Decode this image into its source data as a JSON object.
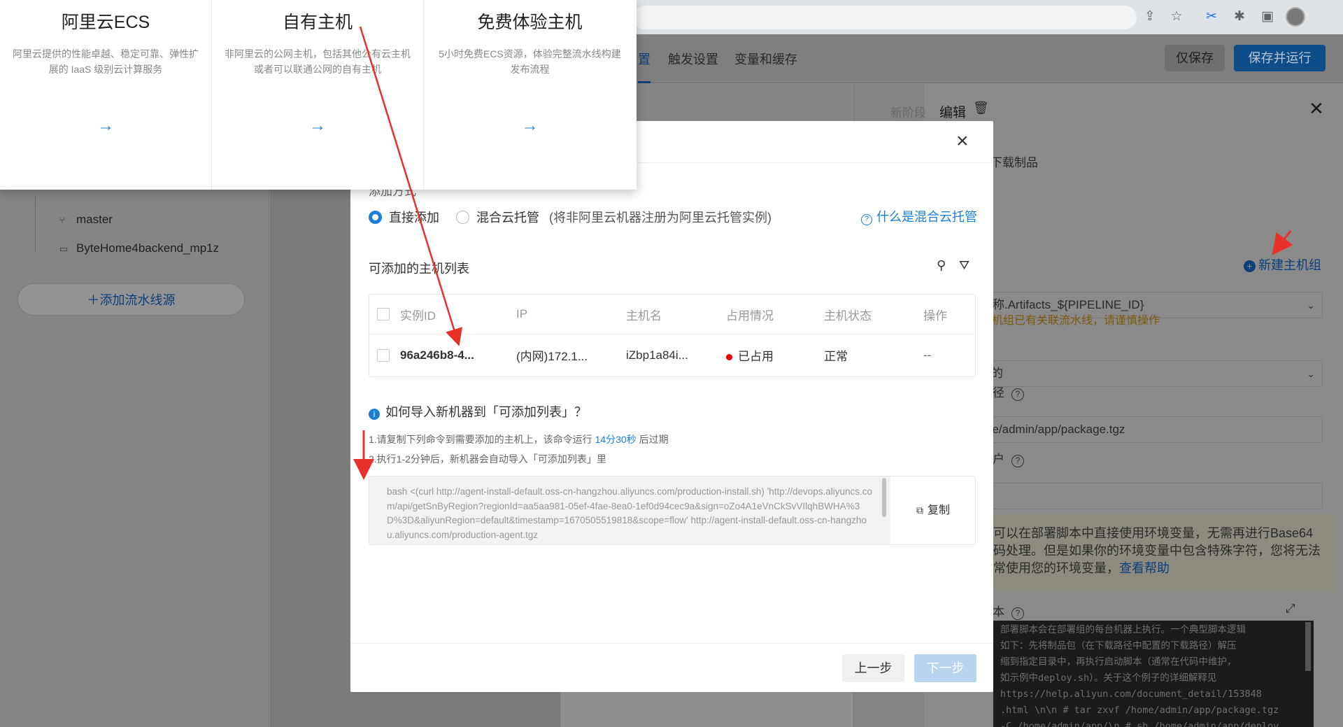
{
  "browser": {
    "icons": [
      "share-icon",
      "star-icon",
      "scissors-icon",
      "puzzle-icon",
      "sidebar-icon",
      "avatar"
    ]
  },
  "header": {
    "tabs": [
      {
        "label": "置"
      },
      {
        "label": "触发设置"
      },
      {
        "label": "变量和缓存"
      }
    ],
    "save_label": "仅保存",
    "run_label": "保存并运行"
  },
  "left": {
    "tree": [
      {
        "icon": "branch-icon",
        "label": "master"
      },
      {
        "icon": "folder-icon",
        "label": "ByteHome4backend_mp1z"
      }
    ],
    "add_source": "添加流水线源"
  },
  "right": {
    "new_stage": "新阶段",
    "edit": "编辑",
    "download_artifact": "下载制品",
    "artifact_name": "称.Artifacts_${PIPELINE_ID}",
    "new_host_group": "新建主机组",
    "host_select": "的",
    "warning": "机组已有关联流水线，请谨慎操作",
    "path_label": "径",
    "path_value": "ne/admin/app/package.tgz",
    "user_label": "户",
    "note_line1": "可以在部署脚本中直接使用环境变量，无需再进行Base64",
    "note_line2": "码处理。但是如果你的环境变量中包含特殊字符，您将无法",
    "note_line3": "常使用您的环境变量，",
    "note_link": "查看帮助",
    "script_label": "本",
    "code_lines": [
      "部署脚本会在部署组的每台机器上执行。一个典型脚本逻辑",
      "  如下：先将制品包（在下载路径中配置的下载路径）解压",
      "  缩到指定目录中，再执行启动脚本（通常在代码中维护，",
      "  如示例中deploy.sh）。关于这个例子的详细解释见",
      "https://help.aliyun.com/document_detail/153848",
      "  .html \\n\\n # tar zxvf /home/admin/app/package.tgz",
      "  -C /home/admin/app/\\n # sh /home/admin/app/deploy"
    ]
  },
  "popover": {
    "cards": [
      {
        "title": "阿里云ECS",
        "desc": "阿里云提供的性能卓越、稳定可靠、弹性扩展的 IaaS 级别云计算服务",
        "arrow": "→"
      },
      {
        "title": "自有主机",
        "desc": "非阿里云的公网主机，包括其他公有云主机或者可以联通公网的自有主机",
        "arrow": "→"
      },
      {
        "title": "免费体验主机",
        "desc": "5小时免费ECS资源，体验完整流水线构建发布流程",
        "arrow": "→"
      }
    ]
  },
  "modal": {
    "mode_label": "添加方式",
    "radio_direct": "直接添加",
    "radio_hybrid": "混合云托管",
    "radio_hint": "(将非阿里云机器注册为阿里云托管实例)",
    "what_link": "什么是混合云托管",
    "list_title": "可添加的主机列表",
    "columns": [
      "实例ID",
      "IP",
      "主机名",
      "占用情况",
      "主机状态",
      "操作"
    ],
    "rows": [
      {
        "id": "96a246b8-4...",
        "ip": "(内网)172.1...",
        "hostname": "iZbp1a84i...",
        "usage": "已占用",
        "status": "正常",
        "action": "--"
      }
    ],
    "import_question": "如何导入新机器到「可添加列表」？",
    "step1_prefix": "1.请复制下列命令到需要添加的主机上，该命令运行 ",
    "step1_countdown": "14分30秒",
    "step1_suffix": " 后过期",
    "step2": "2.执行1-2分钟后，新机器会自动导入「可添加列表」里",
    "command": "bash <(curl http://agent-install-default.oss-cn-hangzhou.aliyuncs.com/production-install.sh) 'http://devops.aliyuncs.com/api/getSnByRegion?regionId=aa5aa981-05ef-4fae-8ea0-1ef0d94cec9a&sign=oZo4A1eVnCkSvVIlqhBWHA%3D%3D&aliyunRegion=default&timestamp=1670505519818&scope=flow' http://agent-install-default.oss-cn-hangzhou.aliyuncs.com/production-agent.tgz",
    "copy_label": "复制",
    "prev_label": "上一步",
    "next_label": "下一步"
  },
  "colors": {
    "primary": "#1b7fd8",
    "annotation": "#e8312a",
    "occupied": "#e00000"
  }
}
